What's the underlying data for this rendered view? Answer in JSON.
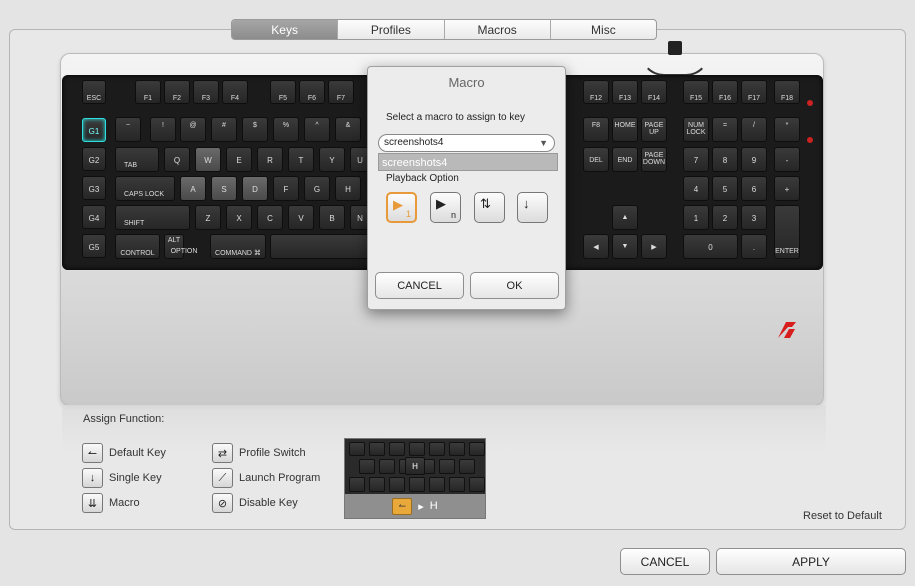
{
  "tabs": [
    {
      "label": "Keys",
      "active": true
    },
    {
      "label": "Profiles",
      "active": false
    },
    {
      "label": "Macros",
      "active": false
    },
    {
      "label": "Misc",
      "active": false
    }
  ],
  "keyboard": {
    "gkeys": [
      "G1",
      "G2",
      "G3",
      "G4",
      "G5"
    ],
    "row0": [
      "ESC",
      "F1",
      "F2",
      "F3",
      "F4",
      "F5",
      "F6",
      "F7",
      "F12",
      "F13",
      "F14",
      "F15",
      "F16",
      "F17",
      "F18",
      "F19"
    ],
    "row1": [
      "~",
      "!",
      "@",
      "#",
      "$",
      "%",
      "^",
      "&",
      "F8",
      "HOME",
      "PAGE UP",
      "NUM LOCK",
      "=",
      "/",
      "*"
    ],
    "row2": [
      "TAB",
      "Q",
      "W",
      "E",
      "R",
      "T",
      "Y",
      "U",
      "DEL",
      "END",
      "PAGE DOWN",
      "7",
      "8",
      "9",
      "-"
    ],
    "row3": [
      "CAPS LOCK",
      "A",
      "S",
      "D",
      "F",
      "G",
      "H",
      "4",
      "5",
      "6",
      "+"
    ],
    "row4": [
      "SHIFT",
      "Z",
      "X",
      "C",
      "V",
      "B",
      "N",
      "1",
      "2",
      "3"
    ],
    "row5": [
      "CONTROL",
      "ALT",
      "OPTION",
      "COMMAND ⌘",
      "0",
      ".",
      "ENTER"
    ],
    "accent": "#2fe0e0",
    "logo_color": "#d81d1d"
  },
  "modal": {
    "title": "Macro",
    "prompt": "Select a macro to assign to key",
    "selected_macro": "screenshots4",
    "dropdown_option": "screenshots4",
    "playback_label": "Playback Option",
    "playback_options": [
      {
        "name": "play-once",
        "sub": "1",
        "selected": true
      },
      {
        "name": "play-n",
        "sub": "n",
        "selected": false
      },
      {
        "name": "play-while-held",
        "sub": "",
        "selected": false
      },
      {
        "name": "play-toggle",
        "sub": "",
        "selected": false
      }
    ],
    "cancel_label": "CANCEL",
    "ok_label": "OK"
  },
  "assign": {
    "title": "Assign Function:",
    "functions": [
      {
        "label": "Default Key",
        "icon": "arrow-left-icon"
      },
      {
        "label": "Single Key",
        "icon": "down-arrow-icon"
      },
      {
        "label": "Macro",
        "icon": "macro-icon"
      },
      {
        "label": "Profile Switch",
        "icon": "switch-icon"
      },
      {
        "label": "Launch Program",
        "icon": "launch-icon"
      },
      {
        "label": "Disable Key",
        "icon": "disable-icon"
      }
    ],
    "preview_key": "H",
    "preview_result": "H",
    "reset_label": "Reset to Default"
  },
  "footer": {
    "cancel_label": "CANCEL",
    "apply_label": "APPLY"
  },
  "colors": {
    "selected_outline": "#e8993a"
  }
}
